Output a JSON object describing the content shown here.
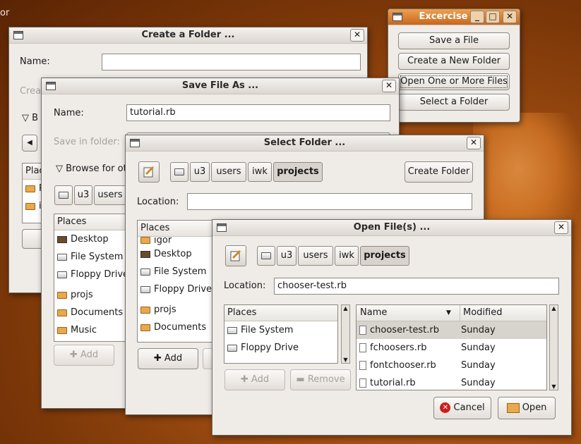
{
  "desktop": {
    "text": "or"
  },
  "excercise": {
    "title": "Excercise",
    "buttons": [
      "Save a File",
      "Create a New Folder",
      "Open One or More Files",
      "Select a Folder"
    ]
  },
  "create_folder": {
    "title": "Create a Folder ...",
    "name_label": "Name:",
    "name_value": "",
    "create_label": "Crea",
    "browse_label": "B",
    "places_header": "Plac",
    "place_items": [
      "R",
      "ig"
    ]
  },
  "save_file": {
    "title": "Save File As ...",
    "name_label": "Name:",
    "name_value": "tutorial.rb",
    "save_in_label": "Save in folder:",
    "browse_label": "Browse for ot",
    "crumbs": [
      "u3",
      "users"
    ],
    "places_header": "Places",
    "places": [
      "Desktop",
      "File System",
      "Floppy Drive",
      "projs",
      "Documents",
      "Music"
    ],
    "add_label": "Add"
  },
  "select_folder": {
    "title": "Select Folder ...",
    "crumbs": [
      "u3",
      "users",
      "iwk",
      "projects"
    ],
    "create_folder_label": "Create Folder",
    "location_label": "Location:",
    "location_value": "",
    "places_header": "Places",
    "places": [
      "igor",
      "Desktop",
      "File System",
      "Floppy Drive",
      "projs",
      "Documents"
    ],
    "add_label": "Add"
  },
  "open_files": {
    "title": "Open File(s) ...",
    "crumbs": [
      "u3",
      "users",
      "iwk",
      "projects"
    ],
    "location_label": "Location:",
    "location_value": "chooser-test.rb",
    "places_header": "Places",
    "places": [
      "File System",
      "Floppy Drive"
    ],
    "add_label": "Add",
    "remove_label": "Remove",
    "col_name": "Name",
    "col_modified": "Modified",
    "files": [
      {
        "name": "chooser-test.rb",
        "modified": "Sunday"
      },
      {
        "name": "fchoosers.rb",
        "modified": "Sunday"
      },
      {
        "name": "fontchooser.rb",
        "modified": "Sunday"
      },
      {
        "name": "tutorial.rb",
        "modified": "Sunday"
      }
    ],
    "cancel_label": "Cancel",
    "open_label": "Open"
  }
}
